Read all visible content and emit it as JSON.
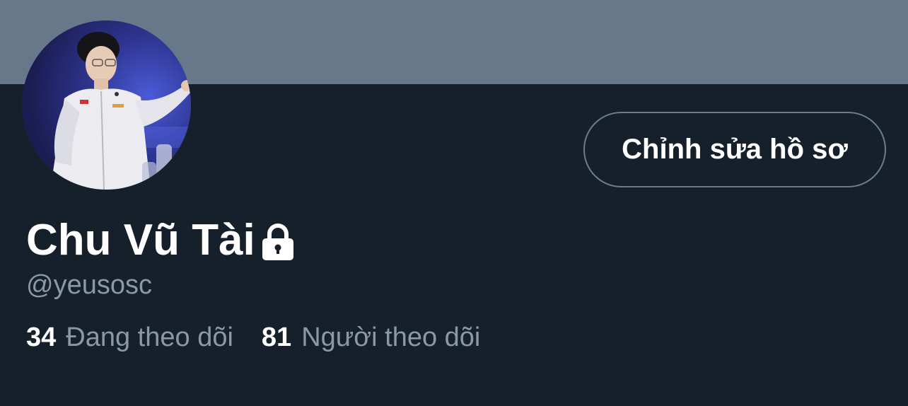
{
  "profile": {
    "display_name": "Chu Vũ Tài",
    "handle": "@yeusosc",
    "edit_button_label": "Chỉnh sửa hồ sơ",
    "protected_icon": "lock-icon",
    "avatar_icon": "profile-photo"
  },
  "stats": {
    "following_count": "34",
    "following_label": "Đang theo dõi",
    "followers_count": "81",
    "followers_label": "Người theo dõi"
  },
  "colors": {
    "background": "#15202b",
    "banner": "#66788a",
    "primary_text": "#ffffff",
    "secondary_text": "#8b98a5",
    "button_border": "#6b7c8c"
  }
}
